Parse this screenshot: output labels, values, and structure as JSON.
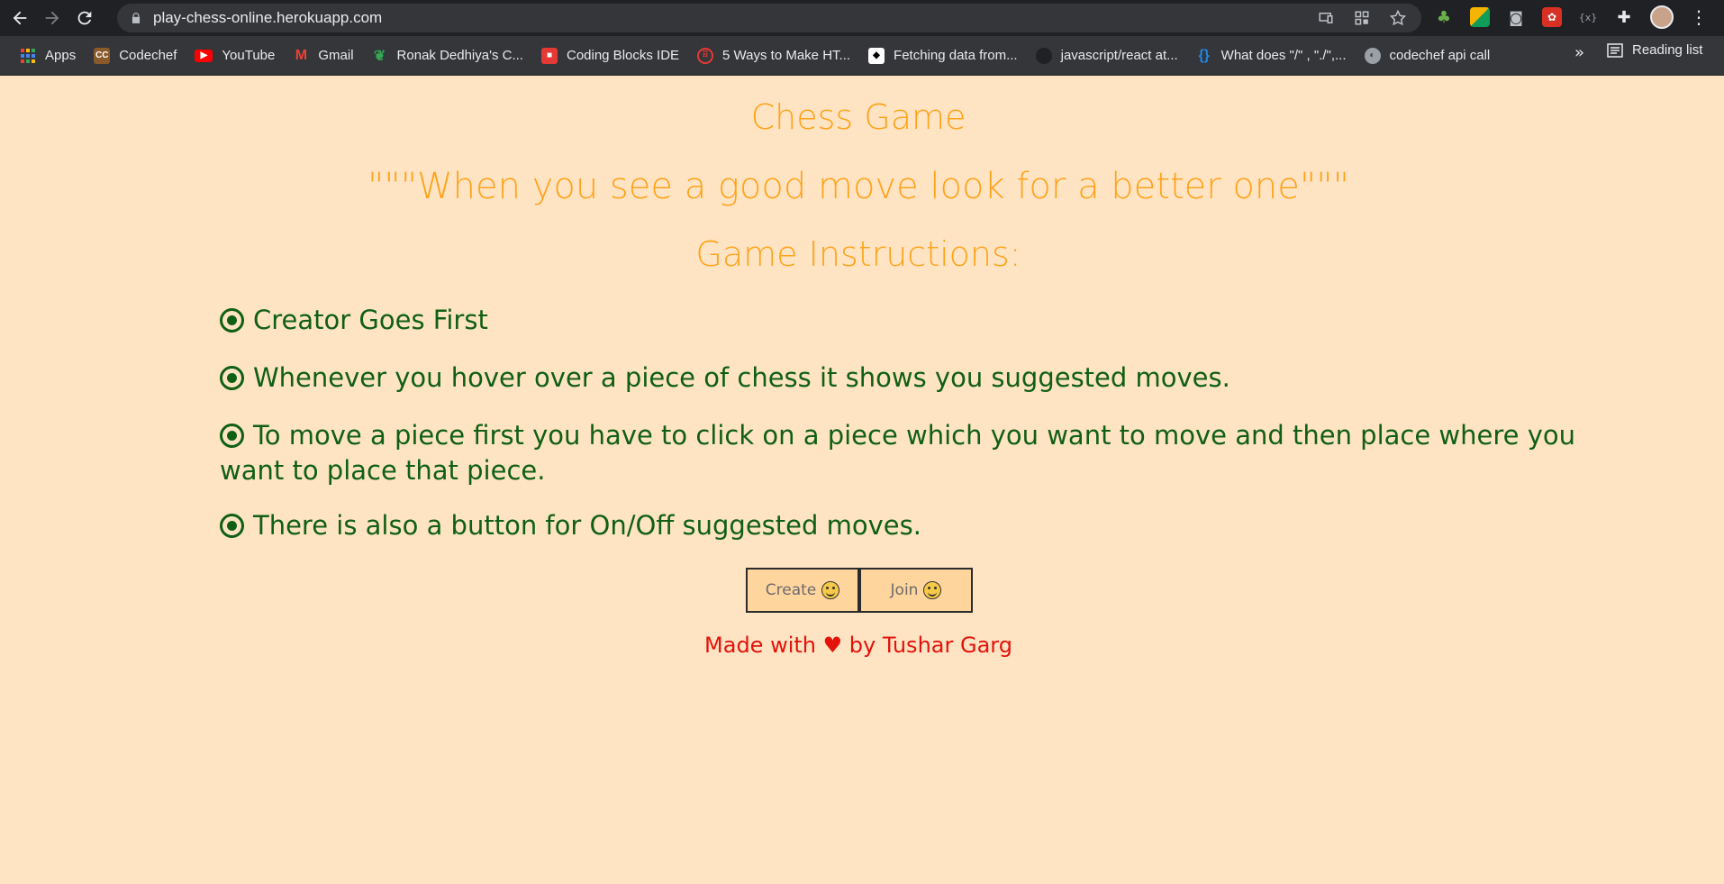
{
  "browser": {
    "url": "play-chess-online.herokuapp.com",
    "bookmarks": [
      {
        "label": "Apps",
        "icon": "apps-grid-icon",
        "color": "#4285f4"
      },
      {
        "label": "Codechef",
        "icon": "codechef-icon",
        "color": "#8b5a2b"
      },
      {
        "label": "YouTube",
        "icon": "youtube-icon",
        "color": "#ff0000"
      },
      {
        "label": "Gmail",
        "icon": "gmail-icon",
        "color": "#ea4335"
      },
      {
        "label": "Ronak Dedhiya's C...",
        "icon": "leaf-icon",
        "color": "#34a853"
      },
      {
        "label": "Coding Blocks IDE",
        "icon": "cube-icon",
        "color": "#e53935"
      },
      {
        "label": "5 Ways to Make HT...",
        "icon": "circle-icon",
        "color": "#e53935"
      },
      {
        "label": "Fetching data from...",
        "icon": "favicon-icon",
        "color": "#ffffff"
      },
      {
        "label": "javascript/react at...",
        "icon": "github-icon",
        "color": "#202124"
      },
      {
        "label": "What does \"/\" , \"./\",...",
        "icon": "braces-icon",
        "color": "#1e88e5"
      },
      {
        "label": "codechef api call",
        "icon": "globe-icon",
        "color": "#9aa0a6"
      }
    ],
    "more": "»",
    "reading_list": "Reading list"
  },
  "page": {
    "title": "Chess Game",
    "quote": "\"\"\"When you see a good move look for a better one\"\"\"",
    "instructions_heading": "Game Instructions:",
    "instructions": [
      "Creator Goes First",
      "Whenever you hover over a piece of chess it shows you suggested moves.",
      "To move a piece first you have to click on a piece which you want to move and then place where you want to place that piece.",
      "There is also a button for On/Off suggested moves."
    ],
    "buttons": {
      "create_label": "Create",
      "join_label": "Join"
    },
    "credit": "Made with ♥ by Tushar Garg"
  },
  "colors": {
    "background": "#ffe4c4",
    "heading": "#ffa31a",
    "instruction_text": "#0f5f14",
    "credit_text": "#e3120b",
    "button_bg": "#ffd59e"
  }
}
